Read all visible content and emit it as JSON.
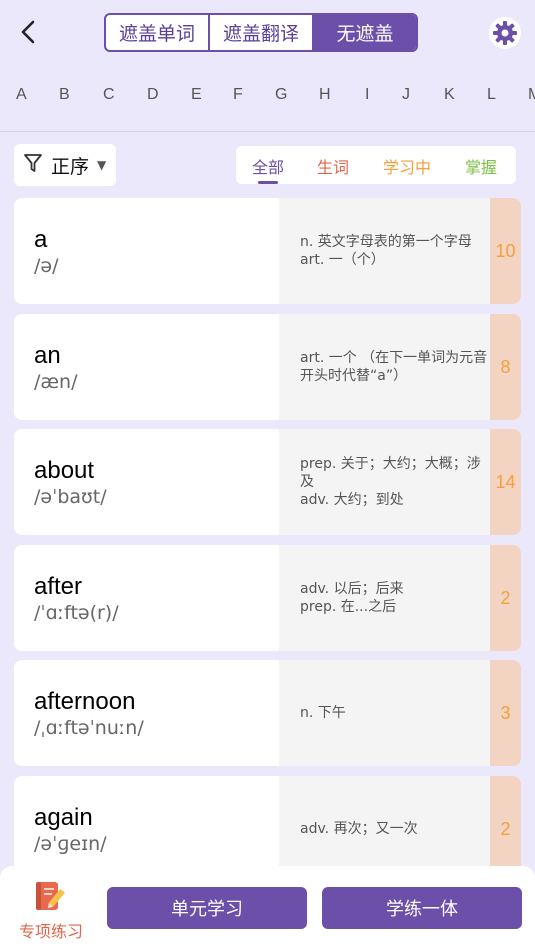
{
  "header": {
    "segments": [
      {
        "label": "遮盖单词",
        "active": false
      },
      {
        "label": "遮盖翻译",
        "active": false
      },
      {
        "label": "无遮盖",
        "active": true
      }
    ],
    "back_icon": "chevron-left-icon",
    "settings_icon": "gear-icon"
  },
  "alphabet": [
    "A",
    "B",
    "C",
    "D",
    "E",
    "F",
    "G",
    "H",
    "I",
    "J",
    "K",
    "L",
    "M"
  ],
  "sort": {
    "label": "正序",
    "icon": "filter-icon"
  },
  "filters": [
    {
      "label": "全部",
      "color": "#6b4fa8",
      "active": true
    },
    {
      "label": "生词",
      "color": "#e0664b",
      "active": false
    },
    {
      "label": "学习中",
      "color": "#f3a13b",
      "active": false
    },
    {
      "label": "掌握",
      "color": "#7bc24a",
      "active": false
    }
  ],
  "words": [
    {
      "word": "a",
      "phonetic": "/ə/",
      "meaning": "n. 英文字母表的第一个字母\nart. 一（个）",
      "count": "10"
    },
    {
      "word": "an",
      "phonetic": "/æn/",
      "meaning": "art. 一个 （在下一单词为元音开头时代替“a”）",
      "count": "8"
    },
    {
      "word": "about",
      "phonetic": "/əˈbaʊt/",
      "meaning": "prep. 关于；大约；大概；涉及\nadv. 大约；到处",
      "count": "14"
    },
    {
      "word": "after",
      "phonetic": "/ˈɑːftə(r)/",
      "meaning": "adv. 以后；后来\nprep. 在...之后",
      "count": "2"
    },
    {
      "word": "afternoon",
      "phonetic": "/ˌɑːftəˈnuːn/",
      "meaning": "n. 下午",
      "count": "3"
    },
    {
      "word": "again",
      "phonetic": "/əˈɡeɪn/",
      "meaning": "adv. 再次；又一次",
      "count": "2"
    }
  ],
  "bottom": {
    "practice_label": "专项练习",
    "practice_icon": "notebook-pencil-icon",
    "unit_study": "单元学习",
    "practice_combo": "学练一体"
  },
  "colors": {
    "accent": "#6b4fa8",
    "background": "#ebe8fb",
    "count_bg": "#f3d3c2",
    "count_text": "#f3a13b"
  }
}
